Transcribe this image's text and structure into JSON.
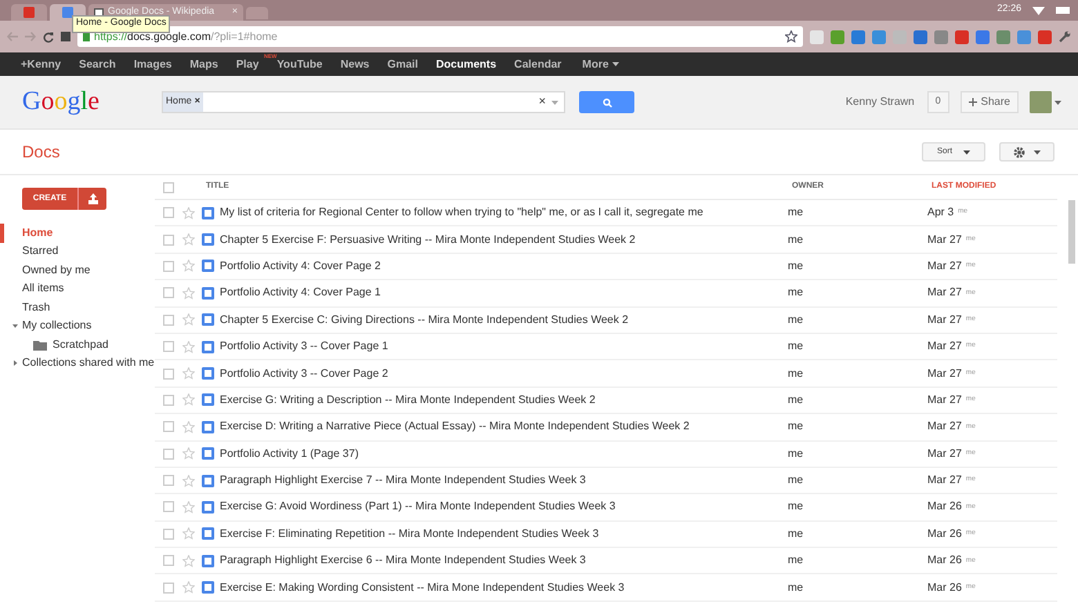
{
  "browser": {
    "tabs": [
      {
        "kind": "icon",
        "selected": false
      },
      {
        "kind": "icon",
        "selected": true
      },
      {
        "kind": "text",
        "title": "Google Docs - Wikipedia",
        "close": "×",
        "selected": false
      }
    ],
    "tooltip": "Home - Google Docs",
    "clock": "22:26",
    "url_scheme": "https://",
    "url_host": "docs.google.com",
    "url_path": "/?pli=1#home"
  },
  "nav": {
    "items": [
      {
        "label": "+Kenny",
        "selected": false
      },
      {
        "label": "Search",
        "selected": false
      },
      {
        "label": "Images",
        "selected": false
      },
      {
        "label": "Maps",
        "selected": false
      },
      {
        "label": "Play",
        "selected": false,
        "badge": "NEW"
      },
      {
        "label": "YouTube",
        "selected": false
      },
      {
        "label": "News",
        "selected": false
      },
      {
        "label": "Gmail",
        "selected": false
      },
      {
        "label": "Documents",
        "selected": true
      },
      {
        "label": "Calendar",
        "selected": false
      }
    ],
    "more": "More"
  },
  "header": {
    "logo": "Google",
    "search": {
      "chip": "Home",
      "chip_close": "×",
      "clear": "×"
    },
    "user": "Kenny Strawn",
    "notifications": "0",
    "share": "Share"
  },
  "toolbar": {
    "title": "Docs",
    "sort": "Sort"
  },
  "sidebar": {
    "create": "CREATE",
    "items": [
      {
        "label": "Home",
        "kind": "link",
        "selected": true
      },
      {
        "label": "Starred",
        "kind": "link",
        "selected": false
      },
      {
        "label": "Owned by me",
        "kind": "link",
        "selected": false
      },
      {
        "label": "All items",
        "kind": "link",
        "selected": false
      },
      {
        "label": "Trash",
        "kind": "link",
        "selected": false
      },
      {
        "label": "My collections",
        "kind": "collection",
        "selected": false,
        "expanded": true,
        "children": [
          {
            "label": "Scratchpad",
            "kind": "folder",
            "selected": false
          }
        ]
      },
      {
        "label": "Collections shared with me",
        "kind": "collection",
        "selected": false,
        "expanded": false
      }
    ]
  },
  "table": {
    "select_all_checked": false,
    "columns": [
      {
        "label": "TITLE",
        "sorted": false
      },
      {
        "label": "OWNER",
        "sorted": false
      },
      {
        "label": "LAST MODIFIED",
        "sorted": true
      }
    ],
    "rows": [
      {
        "title": "My list of criteria for Regional Center to follow when trying to \"help\" me, or as I call it, segregate me",
        "owner": "me",
        "date": "Apr 3",
        "modifier": "me",
        "checked": false,
        "starred": false
      },
      {
        "title": "Chapter 5 Exercise F: Persuasive Writing -- Mira Monte Independent Studies Week 2",
        "owner": "me",
        "date": "Mar 27",
        "modifier": "me",
        "checked": false,
        "starred": false
      },
      {
        "title": "Portfolio Activity 4: Cover Page 2",
        "owner": "me",
        "date": "Mar 27",
        "modifier": "me",
        "checked": false,
        "starred": false
      },
      {
        "title": "Portfolio Activity 4: Cover Page 1",
        "owner": "me",
        "date": "Mar 27",
        "modifier": "me",
        "checked": false,
        "starred": false
      },
      {
        "title": "Chapter 5 Exercise C: Giving Directions -- Mira Monte Independent Studies Week 2",
        "owner": "me",
        "date": "Mar 27",
        "modifier": "me",
        "checked": false,
        "starred": false
      },
      {
        "title": "Portfolio Activity 3 -- Cover Page 1",
        "owner": "me",
        "date": "Mar 27",
        "modifier": "me",
        "checked": false,
        "starred": false
      },
      {
        "title": "Portfolio Activity 3 -- Cover Page 2",
        "owner": "me",
        "date": "Mar 27",
        "modifier": "me",
        "checked": false,
        "starred": false
      },
      {
        "title": "Exercise G: Writing a Description -- Mira Monte Independent Studies Week 2",
        "owner": "me",
        "date": "Mar 27",
        "modifier": "me",
        "checked": false,
        "starred": false
      },
      {
        "title": "Exercise D: Writing a Narrative Piece (Actual Essay) -- Mira Monte Independent Studies Week 2",
        "owner": "me",
        "date": "Mar 27",
        "modifier": "me",
        "checked": false,
        "starred": false
      },
      {
        "title": "Portfolio Activity 1 (Page 37)",
        "owner": "me",
        "date": "Mar 27",
        "modifier": "me",
        "checked": false,
        "starred": false
      },
      {
        "title": "Paragraph Highlight Exercise 7 -- Mira Monte Independent Studies Week 3",
        "owner": "me",
        "date": "Mar 27",
        "modifier": "me",
        "checked": false,
        "starred": false
      },
      {
        "title": "Exercise G: Avoid Wordiness (Part 1) -- Mira Monte Independent Studies Week 3",
        "owner": "me",
        "date": "Mar 26",
        "modifier": "me",
        "checked": false,
        "starred": false
      },
      {
        "title": "Exercise F: Eliminating Repetition -- Mira Monte Independent Studies Week 3",
        "owner": "me",
        "date": "Mar 26",
        "modifier": "me",
        "checked": false,
        "starred": false
      },
      {
        "title": "Paragraph Highlight Exercise 6 -- Mira Monte Independent Studies Week 3",
        "owner": "me",
        "date": "Mar 26",
        "modifier": "me",
        "checked": false,
        "starred": false
      },
      {
        "title": "Exercise E: Making Wording Consistent -- Mira Mone Independent Studies Week 3",
        "owner": "me",
        "date": "Mar 26",
        "modifier": "me",
        "checked": false,
        "starred": false
      }
    ]
  }
}
